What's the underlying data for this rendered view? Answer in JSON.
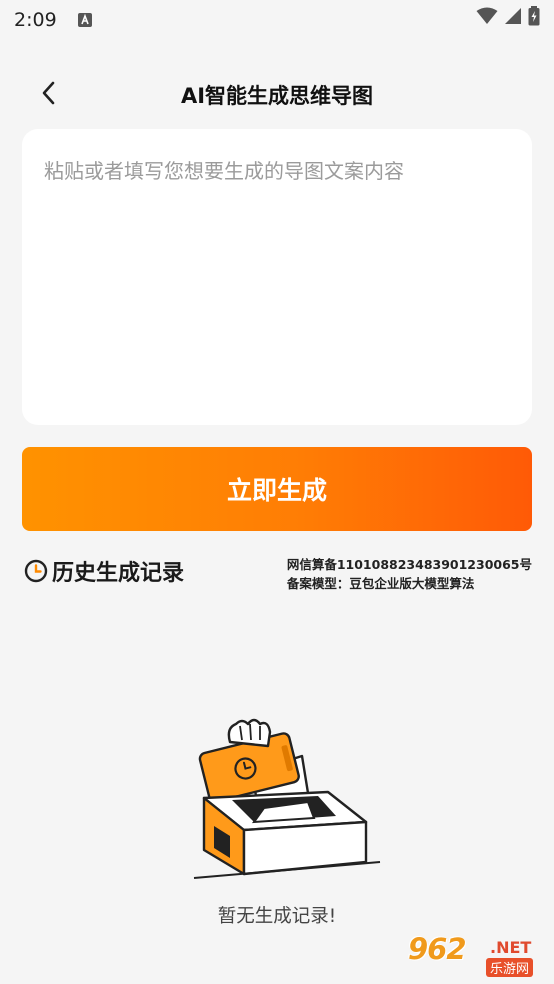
{
  "status_bar": {
    "time": "2:09"
  },
  "nav": {
    "title": "AI智能生成思维导图"
  },
  "input": {
    "placeholder": "粘贴或者填写您想要生成的导图文案内容",
    "value": ""
  },
  "generate_button": {
    "label": "立即生成"
  },
  "history": {
    "title": "历史生成记录"
  },
  "filing": {
    "line1": "网信算备110108823483901230065号",
    "line2": "备案模型：豆包企业版大模型算法"
  },
  "empty_state": {
    "text": "暂无生成记录!"
  },
  "watermark": {
    "main": "962",
    "suffix": ".NET",
    "sub": "乐游网"
  },
  "colors": {
    "accent_start": "#ff9200",
    "accent_end": "#ff5a06",
    "background": "#f5f5f5"
  }
}
